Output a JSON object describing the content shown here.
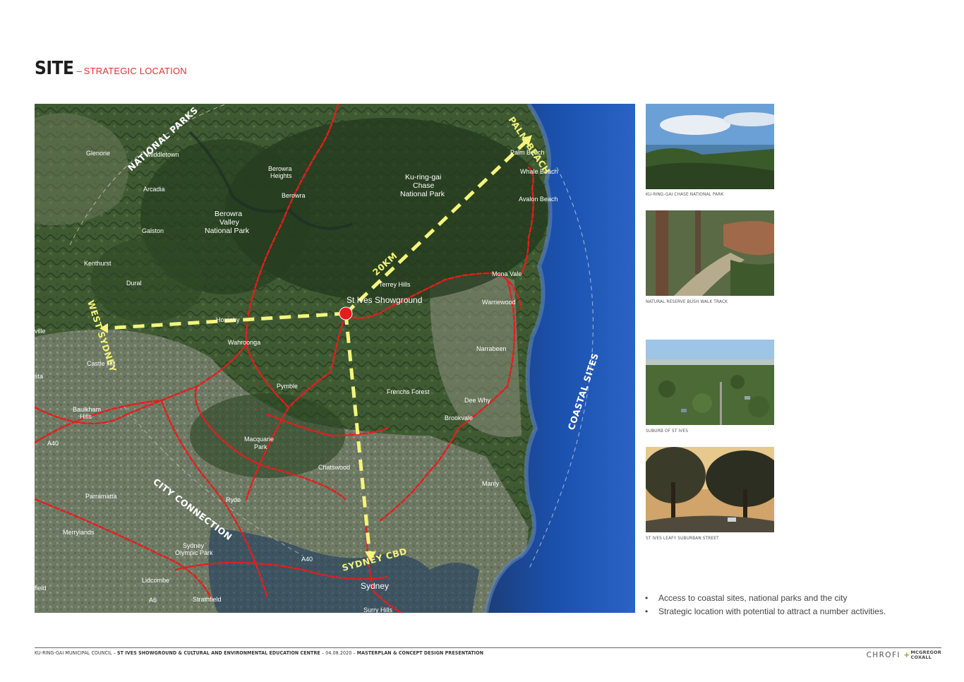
{
  "header": {
    "title": "SITE",
    "dash": "–",
    "subtitle": "STRATEGIC LOCATION"
  },
  "map": {
    "place_labels": {
      "glenorie": "Glenorie",
      "middletown": "Middletown",
      "arcadia": "Arcadia",
      "galston": "Galston",
      "kenthurst": "Kenthurst",
      "dural": "Dural",
      "ville": "ville",
      "castle_hill": "Castle Hill",
      "sta": "sta",
      "baulkham_hills_1": "Baulkham",
      "baulkham_hills_2": "Hills",
      "parramatta": "Parramatta",
      "merrylands": "Merrylands",
      "lidcombe": "Lidcombe",
      "field": "field",
      "strathfield": "Strathfield",
      "sydney_olympic_1": "Sydney",
      "sydney_olympic_2": "Olympic Park",
      "ryde": "Ryde",
      "macquarie_1": "Macquarie",
      "macquarie_2": "Park",
      "chatswood": "Chatswood",
      "pymble": "Pymble",
      "wahroonga": "Wahroonga",
      "hornsby": "Hornsby",
      "berowra_heights_1": "Berowra",
      "berowra_heights_2": "Heights",
      "berowra": "Berowra",
      "berowra_valley_1": "Berowra",
      "berowra_valley_2": "Valley",
      "berowra_valley_3": "National Park",
      "kuringgai_1": "Ku-ring-gai",
      "kuringgai_2": "Chase",
      "kuringgai_3": "National Park",
      "terrey_hills": "Terrey Hills",
      "frenchs_forest": "Frenchs Forest",
      "brookvale": "Brookvale",
      "dee_why": "Dee Why",
      "narrabeen": "Narrabeen",
      "warriewood": "Warriewood",
      "mona_vale": "Mona Vale",
      "avalon_beach": "Avalon Beach",
      "whale_beach": "Whale Beach",
      "palm_beach": "Palm Beach",
      "manly": "Manly",
      "sydney": "Sydney",
      "surry_hills": "Surry Hills",
      "road_a40": "A40",
      "road_a40b": "A40",
      "road_a6": "A6"
    },
    "site_label": "St Ives Showground",
    "overlay": {
      "national_parks": "NATIONAL PARKS",
      "west_sydney": "WEST SYDNEY",
      "city_connection": "CITY CONNECTION",
      "coastal_sites": "COASTAL SITES",
      "palm_beach": "PALM BEACH",
      "distance": "20KM",
      "sydney_cbd": "SYDNEY CBD"
    },
    "colors": {
      "road": "#e81c1c",
      "route": "#f5f57c",
      "site_marker": "#e81c1c",
      "ocean": "#1a4a9a"
    }
  },
  "photos": [
    {
      "icon": "photo-national-park",
      "caption": "KU-RING-GAI CHASE NATIONAL PARK"
    },
    {
      "icon": "photo-bush-walk",
      "caption": "NATURAL RESERVE BUSH WALK TRACK"
    },
    {
      "icon": "photo-aerial-suburb",
      "caption": "SUBURB OF ST IVES"
    },
    {
      "icon": "photo-leafy-street",
      "caption": "ST IVES LEAFY SUBURBAN STREET"
    }
  ],
  "bullets": {
    "marker": "•",
    "items": [
      "Access to coastal sites, national parks and the city",
      "Strategic location with potential to attract a number activities."
    ]
  },
  "footer": {
    "council": "KU-RING-GAI MUNICIPAL COUNCIL",
    "sep1": " – ",
    "project": "ST IVES SHOWGROUND & CULTURAL AND ENVIRONMENTAL EDUCATION CENTRE",
    "sep2": " – ",
    "date": "04.08.2020",
    "sep3": " – ",
    "presentation": "MASTERPLAN & CONCEPT DESIGN PRESENTATION",
    "logo_chrofi": "CHROFI",
    "logo_plus": "+",
    "logo_mcgregor": "MCGREGOR",
    "logo_coxall": "COXALL"
  }
}
